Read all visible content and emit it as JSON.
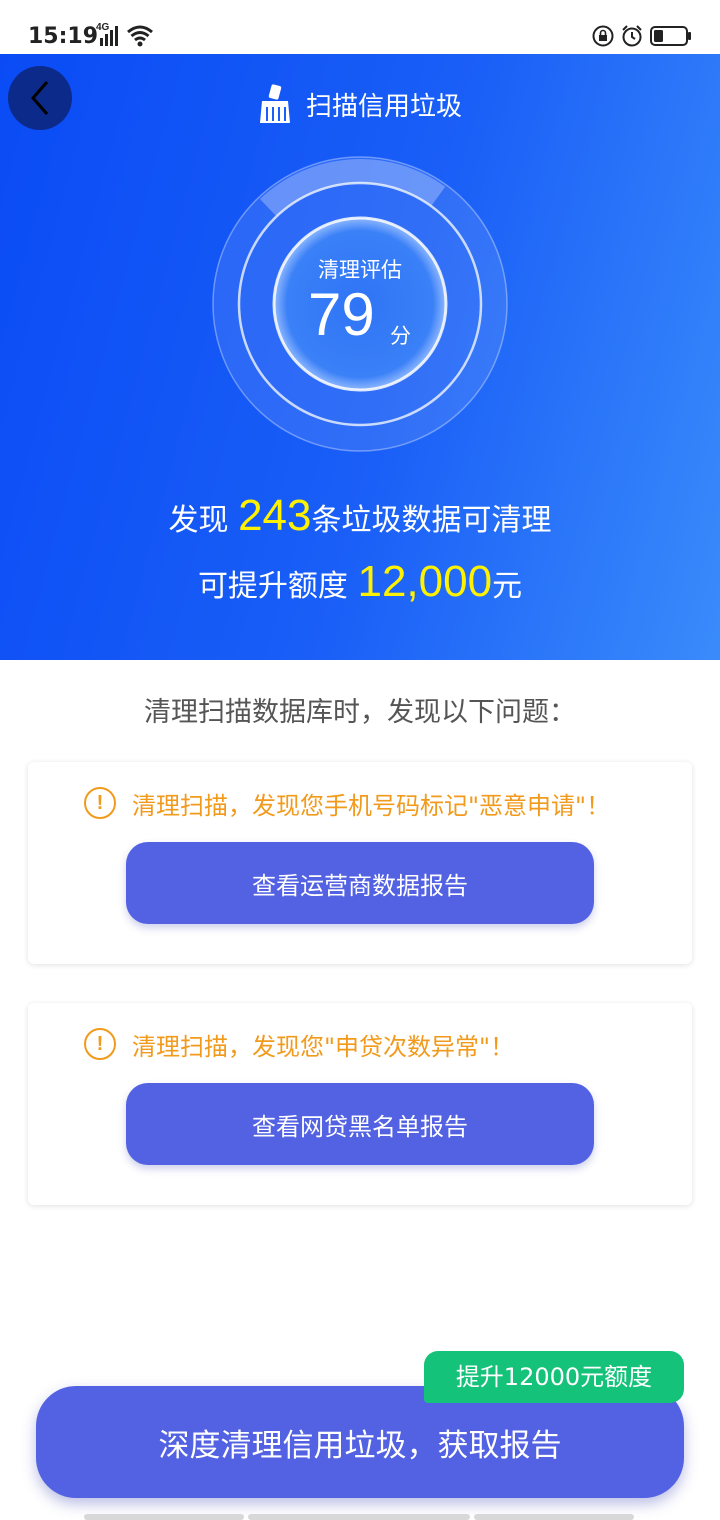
{
  "status_bar": {
    "time": "15:19",
    "network": "4G"
  },
  "header": {
    "title": "扫描信用垃圾"
  },
  "gauge": {
    "label": "清理评估",
    "score": "79",
    "unit": "分",
    "fraction": 0.79
  },
  "summary": {
    "found_prefix": "发现",
    "found_count": "243",
    "found_suffix": "条垃圾数据可清理",
    "quota_prefix": "可提升额度",
    "quota_amount": "12,000",
    "quota_suffix": "元"
  },
  "problems": {
    "heading": "清理扫描数据库时，发现以下问题：",
    "items": [
      {
        "warning": "清理扫描，发现您手机号码标记\"恶意申请\"！",
        "button": "查看运营商数据报告"
      },
      {
        "warning": "清理扫描，发现您\"申贷次数异常\"！",
        "button": "查看网贷黑名单报告"
      }
    ]
  },
  "cta": {
    "label": "深度清理信用垃圾，获取报告",
    "badge": "提升12000元额度"
  },
  "icons": [
    "back-icon",
    "broom-icon",
    "warning-icon",
    "signal-icon",
    "wifi-icon",
    "lock-icon",
    "alarm-icon",
    "battery-icon"
  ],
  "colors": {
    "hero_blue": "#0a4bf5",
    "highlight_yellow": "#fff200",
    "warning_orange": "#f19a1c",
    "button_purple": "#5362e2",
    "badge_green": "#15c27a"
  }
}
